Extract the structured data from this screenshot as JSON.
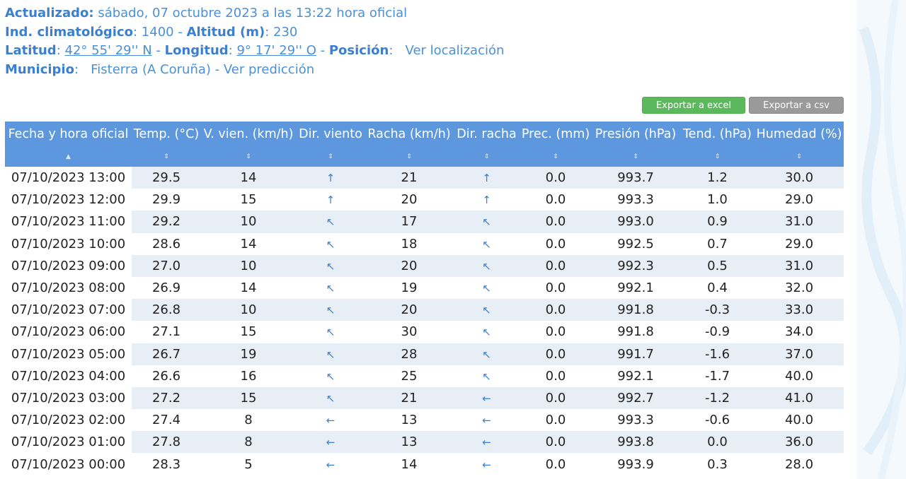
{
  "header": {
    "updated_label": "Actualizado:",
    "updated_value": "sábado, 07 octubre 2023 a las 13:22 hora oficial",
    "ind_label": "Ind. climatológico",
    "ind_value": ": 1400 - ",
    "alt_label": "Altitud (m)",
    "alt_value": ": 230",
    "lat_label": "Latitud",
    "lat_sep": ": ",
    "lat_value": "42° 55' 29'' N",
    "lat_dash": " - ",
    "lon_label": "Longitud",
    "lon_sep": ": ",
    "lon_value": "9° 17' 29'' O",
    "lon_dash": " - ",
    "pos_label": "Posición",
    "pos_value": ":   Ver localización",
    "mun_label": "Municipio",
    "mun_value": ":   Fisterra (A Coruña) - Ver predicción"
  },
  "buttons": {
    "excel": "Exportar a excel",
    "csv": "Exportar a csv"
  },
  "columns": [
    "Fecha y hora oficial",
    "Temp. (°C)",
    "V. vien. (km/h)",
    "Dir. viento",
    "Racha (km/h)",
    "Dir. racha",
    "Prec. (mm)",
    "Presión (hPa)",
    "Tend. (hPa)",
    "Humedad (%)"
  ],
  "sort_icons": {
    "first": "▲",
    "other": "⇕"
  },
  "icons": {
    "arrow_n": "arrow-up-icon",
    "arrow_nw": "arrow-up-left-icon",
    "arrow_w": "arrow-left-icon",
    "accent_color": "#5d97dd"
  },
  "rows": [
    {
      "fecha": "07/10/2023 13:00",
      "temp": "29.5",
      "vv": "14",
      "dv": "↑",
      "racha": "21",
      "dr": "↑",
      "prec": "0.0",
      "pres": "993.7",
      "tend": "1.2",
      "hum": "30.0"
    },
    {
      "fecha": "07/10/2023 12:00",
      "temp": "29.9",
      "vv": "15",
      "dv": "↑",
      "racha": "20",
      "dr": "↑",
      "prec": "0.0",
      "pres": "993.3",
      "tend": "1.0",
      "hum": "29.0"
    },
    {
      "fecha": "07/10/2023 11:00",
      "temp": "29.2",
      "vv": "10",
      "dv": "↖",
      "racha": "17",
      "dr": "↖",
      "prec": "0.0",
      "pres": "993.0",
      "tend": "0.9",
      "hum": "31.0"
    },
    {
      "fecha": "07/10/2023 10:00",
      "temp": "28.6",
      "vv": "14",
      "dv": "↖",
      "racha": "18",
      "dr": "↖",
      "prec": "0.0",
      "pres": "992.5",
      "tend": "0.7",
      "hum": "29.0"
    },
    {
      "fecha": "07/10/2023 09:00",
      "temp": "27.0",
      "vv": "10",
      "dv": "↖",
      "racha": "20",
      "dr": "↖",
      "prec": "0.0",
      "pres": "992.3",
      "tend": "0.5",
      "hum": "31.0"
    },
    {
      "fecha": "07/10/2023 08:00",
      "temp": "26.9",
      "vv": "14",
      "dv": "↖",
      "racha": "19",
      "dr": "↖",
      "prec": "0.0",
      "pres": "992.1",
      "tend": "0.4",
      "hum": "32.0"
    },
    {
      "fecha": "07/10/2023 07:00",
      "temp": "26.8",
      "vv": "10",
      "dv": "↖",
      "racha": "20",
      "dr": "↖",
      "prec": "0.0",
      "pres": "991.8",
      "tend": "-0.3",
      "hum": "33.0"
    },
    {
      "fecha": "07/10/2023 06:00",
      "temp": "27.1",
      "vv": "15",
      "dv": "↖",
      "racha": "30",
      "dr": "↖",
      "prec": "0.0",
      "pres": "991.8",
      "tend": "-0.9",
      "hum": "34.0"
    },
    {
      "fecha": "07/10/2023 05:00",
      "temp": "26.7",
      "vv": "19",
      "dv": "↖",
      "racha": "28",
      "dr": "↖",
      "prec": "0.0",
      "pres": "991.7",
      "tend": "-1.6",
      "hum": "37.0"
    },
    {
      "fecha": "07/10/2023 04:00",
      "temp": "26.6",
      "vv": "16",
      "dv": "↖",
      "racha": "25",
      "dr": "↖",
      "prec": "0.0",
      "pres": "992.1",
      "tend": "-1.7",
      "hum": "40.0"
    },
    {
      "fecha": "07/10/2023 03:00",
      "temp": "27.2",
      "vv": "15",
      "dv": "↖",
      "racha": "21",
      "dr": "←",
      "prec": "0.0",
      "pres": "992.7",
      "tend": "-1.2",
      "hum": "41.0"
    },
    {
      "fecha": "07/10/2023 02:00",
      "temp": "27.4",
      "vv": "8",
      "dv": "←",
      "racha": "13",
      "dr": "←",
      "prec": "0.0",
      "pres": "993.3",
      "tend": "-0.6",
      "hum": "40.0"
    },
    {
      "fecha": "07/10/2023 01:00",
      "temp": "27.8",
      "vv": "8",
      "dv": "←",
      "racha": "13",
      "dr": "←",
      "prec": "0.0",
      "pres": "993.8",
      "tend": "0.0",
      "hum": "36.0"
    },
    {
      "fecha": "07/10/2023 00:00",
      "temp": "28.3",
      "vv": "5",
      "dv": "←",
      "racha": "14",
      "dr": "←",
      "prec": "0.0",
      "pres": "993.9",
      "tend": "0.3",
      "hum": "28.0"
    }
  ]
}
